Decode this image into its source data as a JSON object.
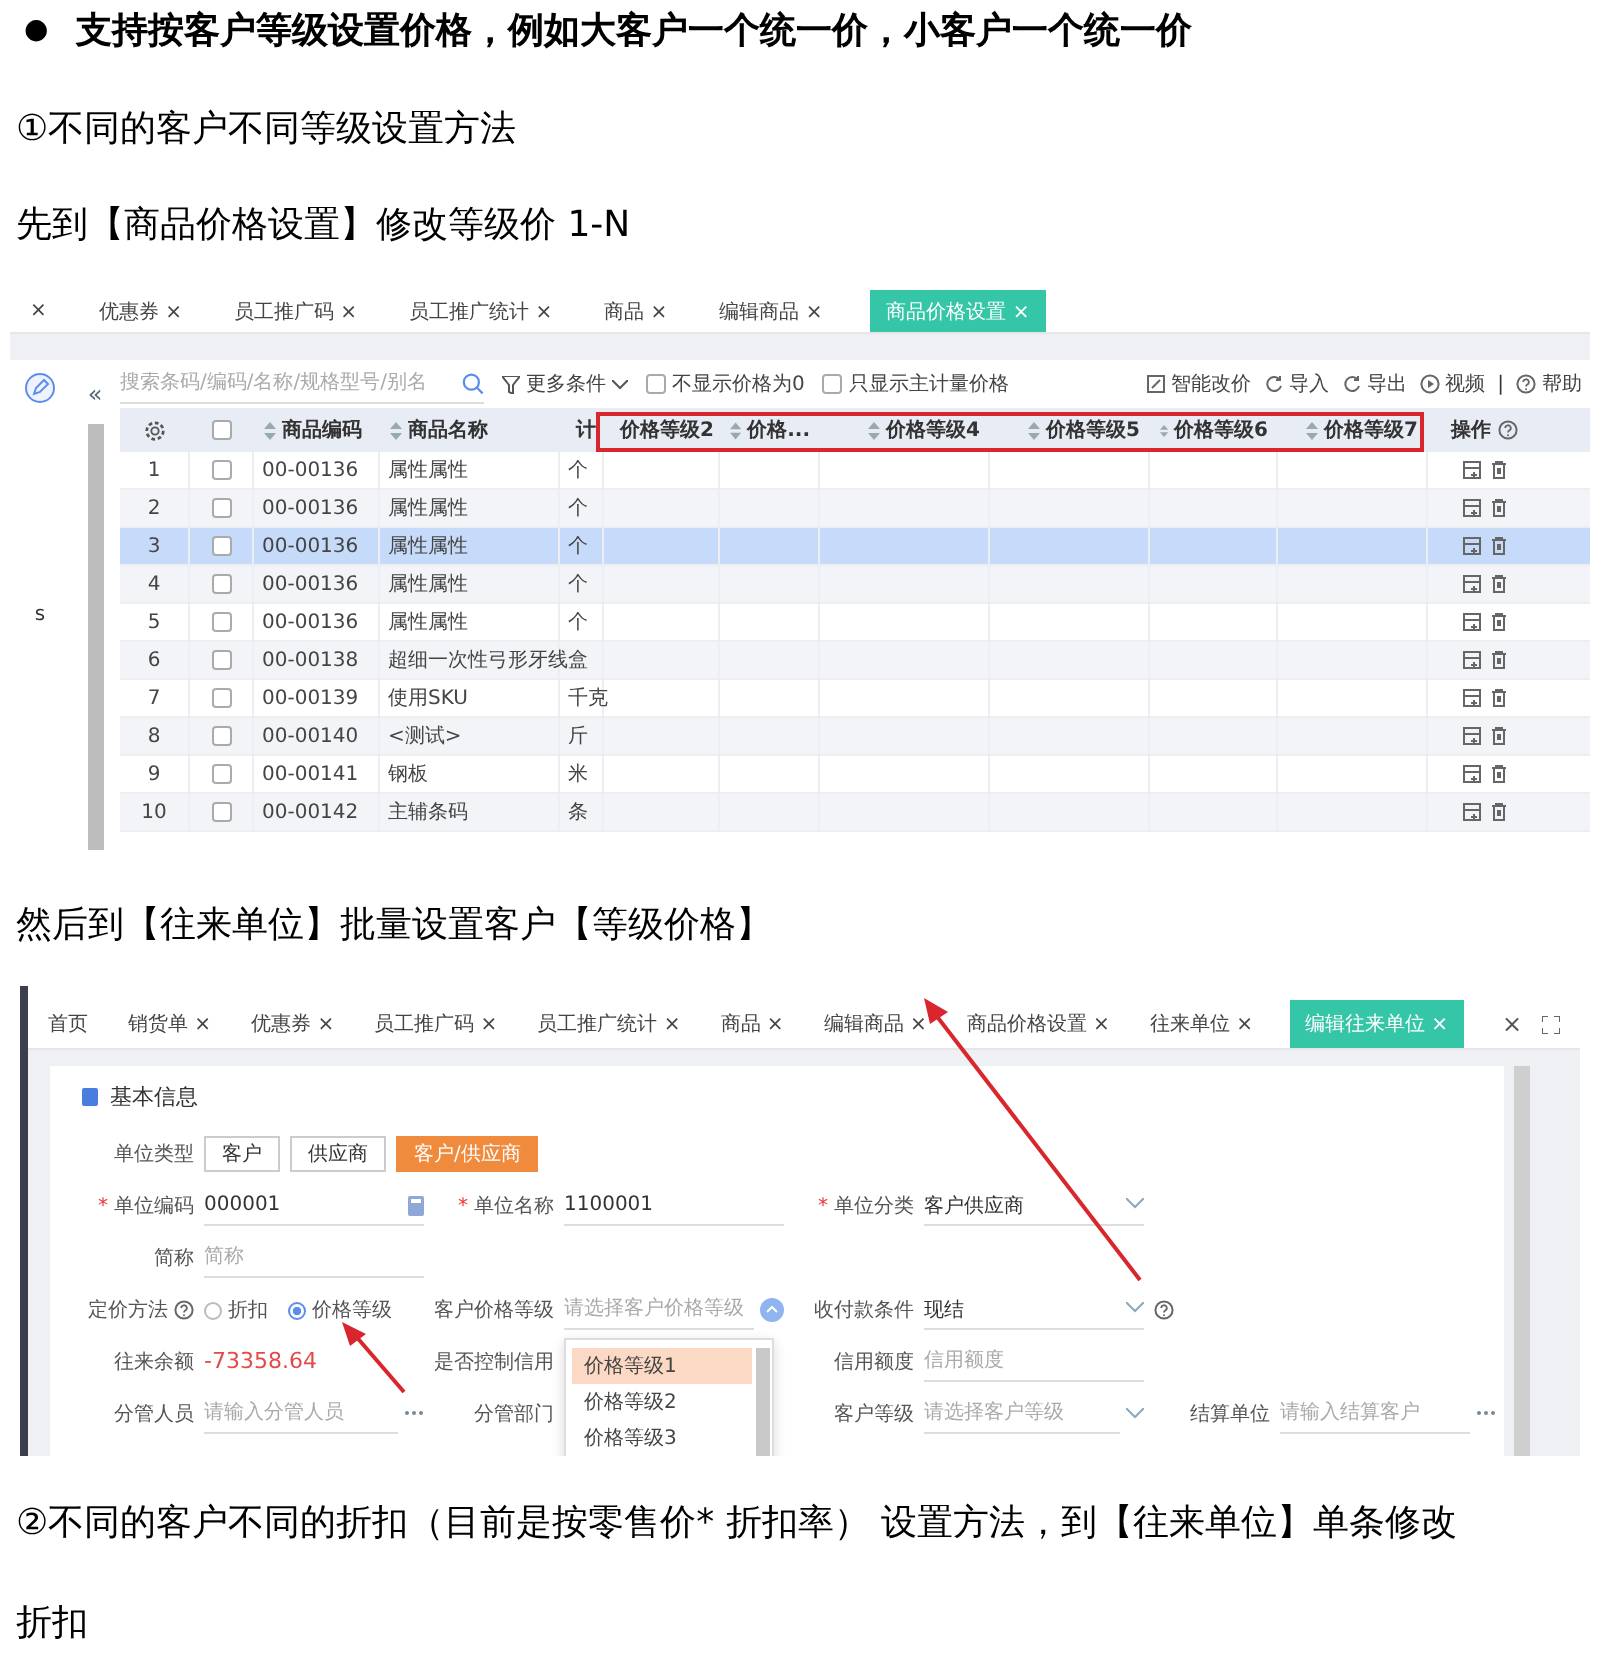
{
  "heading": {
    "bullet": "●",
    "text": "支持按客户等级设置价格，例如大客户一个统一价，小客户一个统一价"
  },
  "step_1": "①不同的客户不同等级设置方法",
  "instruction_1": "先到【商品价格设置】修改等级价 1-N",
  "product_price_screen": {
    "tabs": [
      {
        "label": "×",
        "selected": false
      },
      {
        "label": "优惠券 ×",
        "selected": false
      },
      {
        "label": "员工推广码 ×",
        "selected": false
      },
      {
        "label": "员工推广统计 ×",
        "selected": false
      },
      {
        "label": "商品 ×",
        "selected": false
      },
      {
        "label": "编辑商品 ×",
        "selected": false
      },
      {
        "label": "商品价格设置 ×",
        "selected": true
      }
    ],
    "collapse": "«",
    "side_text": "s",
    "search": {
      "placeholder": "搜索条码/编码/名称/规格型号/别名"
    },
    "more_filter": "更多条件",
    "filters": [
      {
        "label": "不显示价格为0",
        "checked": false
      },
      {
        "label": "只显示主计量价格",
        "checked": false
      }
    ],
    "actions": [
      {
        "kind": "edit",
        "label": "智能改价"
      },
      {
        "kind": "import",
        "label": "导入"
      },
      {
        "kind": "export",
        "label": "导出"
      },
      {
        "kind": "video",
        "label": "视频"
      },
      {
        "kind": "divider",
        "label": "|"
      },
      {
        "kind": "help",
        "label": "帮助"
      }
    ],
    "columns": [
      {
        "label": "商品编码"
      },
      {
        "label": "商品名称"
      },
      {
        "label": "计"
      }
    ],
    "price_columns": [
      {
        "label": "价格等级2"
      },
      {
        "label": "价格..."
      },
      {
        "label": "价格等级4"
      },
      {
        "label": "价格等级5"
      },
      {
        "label": "价格等级6"
      },
      {
        "label": "价格等级7"
      }
    ],
    "select_all": {
      "checked": false
    },
    "action_column": "操作",
    "rows": [
      {
        "index": "1",
        "code": "00-00136",
        "name": "属性属性",
        "unit": "个",
        "checked": false,
        "selected": false
      },
      {
        "index": "2",
        "code": "00-00136",
        "name": "属性属性",
        "unit": "个",
        "checked": false,
        "selected": false
      },
      {
        "index": "3",
        "code": "00-00136",
        "name": "属性属性",
        "unit": "个",
        "checked": false,
        "selected": true
      },
      {
        "index": "4",
        "code": "00-00136",
        "name": "属性属性",
        "unit": "个",
        "checked": false,
        "selected": false
      },
      {
        "index": "5",
        "code": "00-00136",
        "name": "属性属性",
        "unit": "个",
        "checked": false,
        "selected": false
      },
      {
        "index": "6",
        "code": "00-00138",
        "name": "超细一次性弓形牙线",
        "unit": "盒",
        "checked": false,
        "selected": false
      },
      {
        "index": "7",
        "code": "00-00139",
        "name": "使用SKU",
        "unit": "千克",
        "checked": false,
        "selected": false
      },
      {
        "index": "8",
        "code": "00-00140",
        "name": "<测试>",
        "unit": "斤",
        "checked": false,
        "selected": false
      },
      {
        "index": "9",
        "code": "00-00141",
        "name": "钢板",
        "unit": "米",
        "checked": false,
        "selected": false
      },
      {
        "index": "10",
        "code": "00-00142",
        "name": "主辅条码",
        "unit": "条",
        "checked": false,
        "selected": false
      }
    ]
  },
  "instruction_2": "然后到【往来单位】批量设置客户【等级价格】",
  "partner_screen": {
    "tabs": [
      {
        "label": "首页",
        "selected": false
      },
      {
        "label": "销货单 ×",
        "selected": false
      },
      {
        "label": "优惠券 ×",
        "selected": false
      },
      {
        "label": "员工推广码 ×",
        "selected": false
      },
      {
        "label": "员工推广统计 ×",
        "selected": false
      },
      {
        "label": "商品 ×",
        "selected": false
      },
      {
        "label": "编辑商品 ×",
        "selected": false
      },
      {
        "label": "商品价格设置 ×",
        "selected": false
      },
      {
        "label": "往来单位 ×",
        "selected": false
      },
      {
        "label": "编辑往来单位 ×",
        "selected": true
      }
    ],
    "close_all": "×",
    "section_title": "基本信息",
    "unit_type": {
      "label": "单位类型",
      "options": [
        {
          "label": "客户",
          "selected": false
        },
        {
          "label": "供应商",
          "selected": false
        },
        {
          "label": "客户/供应商",
          "selected": true
        }
      ]
    },
    "unit_code": {
      "mark": "*",
      "label": "单位编码",
      "value": "000001"
    },
    "unit_name": {
      "mark": "*",
      "label": "单位名称",
      "value": "1100001"
    },
    "unit_category": {
      "mark": "*",
      "label": "单位分类",
      "value": "客户供应商"
    },
    "short_name": {
      "label": "简称",
      "placeholder": "简称"
    },
    "pricing_method": {
      "label": "定价方法",
      "options": [
        {
          "label": "折扣",
          "selected": false
        },
        {
          "label": "价格等级",
          "selected": true
        }
      ]
    },
    "customer_price_level": {
      "label": "客户价格等级",
      "placeholder": "请选择客户价格等级"
    },
    "payment_terms": {
      "label": "收付款条件",
      "value": "现结"
    },
    "balance": {
      "label": "往来余额",
      "value": "-73358.64"
    },
    "credit_control": {
      "label": "是否控制信用"
    },
    "credit_limit": {
      "label": "信用额度",
      "placeholder": "信用额度"
    },
    "manager": {
      "label": "分管人员",
      "placeholder": "请输入分管人员"
    },
    "department": {
      "label": "分管部门"
    },
    "customer_level": {
      "label": "客户等级",
      "placeholder": "请选择客户等级"
    },
    "settlement_unit": {
      "label": "结算单位",
      "placeholder": "请输入结算客户"
    },
    "price_level_options": [
      {
        "label": "价格等级1",
        "selected": true
      },
      {
        "label": "价格等级2",
        "selected": false
      },
      {
        "label": "价格等级3",
        "selected": false
      }
    ]
  },
  "step_2": {
    "lines": [
      "②不同的客户不同的折扣（目前是按零售价* 折扣率） 设置方法，到【往来单位】单条修改",
      "折扣"
    ]
  }
}
